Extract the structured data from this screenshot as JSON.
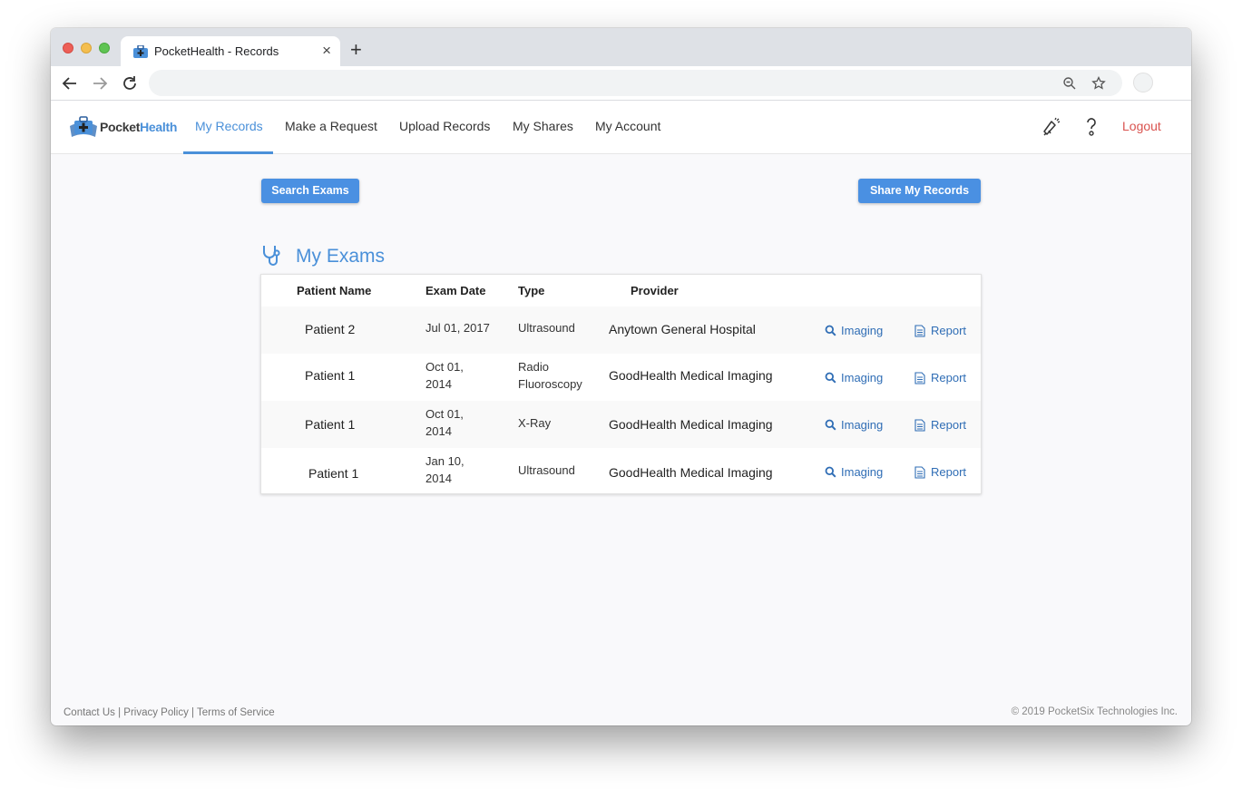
{
  "browser": {
    "tab_title": "PocketHealth - Records",
    "close_glyph": "×",
    "new_tab_glyph": "+",
    "address_value": ""
  },
  "header": {
    "logo_part1": "Pocket",
    "logo_part2": "Health",
    "nav": [
      {
        "label": "My Records",
        "active": true
      },
      {
        "label": "Make a Request",
        "active": false
      },
      {
        "label": "Upload Records",
        "active": false
      },
      {
        "label": "My Shares",
        "active": false
      },
      {
        "label": "My Account",
        "active": false
      }
    ],
    "logout": "Logout"
  },
  "actions": {
    "search_exams": "Search Exams",
    "share_records": "Share My Records"
  },
  "exams": {
    "title": "My Exams",
    "columns": [
      "Patient Name",
      "Exam Date",
      "Type",
      "Provider"
    ],
    "rows": [
      {
        "patient": "Patient 2",
        "date": "Jul 01, 2017",
        "type": "Ultrasound",
        "provider": "Anytown General Hospital",
        "imaging": "Imaging",
        "report": "Report"
      },
      {
        "patient": "Patient 1",
        "date": "Oct 01, 2014",
        "type": "Radio Fluoroscopy",
        "provider": "GoodHealth Medical Imaging",
        "imaging": "Imaging",
        "report": "Report"
      },
      {
        "patient": "Patient 1",
        "date": "Oct 01, 2014",
        "type": "X-Ray",
        "provider": "GoodHealth Medical Imaging",
        "imaging": "Imaging",
        "report": "Report"
      },
      {
        "patient": "Patient 1",
        "date": "Jan 10, 2014",
        "type": "Ultrasound",
        "provider": "GoodHealth Medical Imaging",
        "imaging": "Imaging",
        "report": "Report"
      }
    ]
  },
  "footer": {
    "contact": "Contact Us",
    "privacy": "Privacy Policy",
    "terms": "Terms of Service",
    "separator": " | ",
    "copyright": "© 2019 PocketSix Technologies Inc."
  },
  "icons": {
    "back": "arrow-left-icon",
    "forward": "arrow-right-icon",
    "reload": "reload-icon",
    "zoom": "zoom-out-icon",
    "bookmark": "star-icon",
    "announcements": "megaphone-icon",
    "help": "question-icon",
    "exams": "stethoscope-icon",
    "imaging": "search-icon",
    "report": "document-icon"
  },
  "colors": {
    "brand_blue": "#4a90d9",
    "button_blue": "#4a90e2",
    "logout_red": "#d9534f",
    "link_blue": "#2f6db5"
  }
}
